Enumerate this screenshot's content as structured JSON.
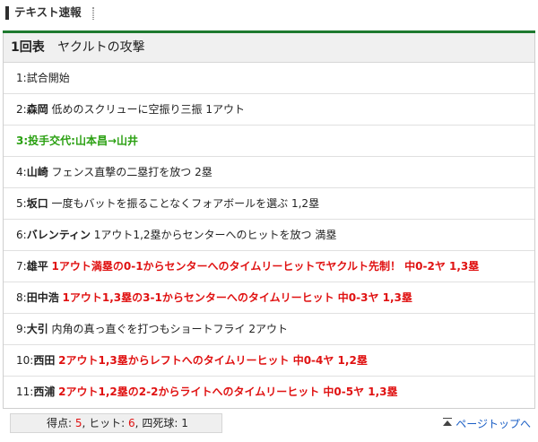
{
  "header": {
    "title": "テキスト速報"
  },
  "inning": {
    "label": "1回表",
    "team": "ヤクルトの攻撃"
  },
  "events": [
    {
      "num": "1:",
      "player": "",
      "desc": "試合開始",
      "style": "normal"
    },
    {
      "num": "2:",
      "player": "森岡",
      "desc": "低めのスクリューに空振り三振 1アウト",
      "style": "normal"
    },
    {
      "num": "3:",
      "player": "",
      "desc": "投手交代:山本昌→山井",
      "style": "sub"
    },
    {
      "num": "4:",
      "player": "山崎",
      "desc": "フェンス直撃の二塁打を放つ 2塁",
      "style": "normal"
    },
    {
      "num": "5:",
      "player": "坂口",
      "desc": "一度もバットを振ることなくフォアボールを選ぶ 1,2塁",
      "style": "normal"
    },
    {
      "num": "6:",
      "player": "バレンティン",
      "desc": "1アウト1,2塁からセンターへのヒットを放つ 満塁",
      "style": "normal"
    },
    {
      "num": "7:",
      "player": "雄平",
      "desc": "1アウト満塁の0-1からセンターへのタイムリーヒットでヤクルト先制！ 中0-2ヤ 1,3塁",
      "style": "red"
    },
    {
      "num": "8:",
      "player": "田中浩",
      "desc": "1アウト1,3塁の3-1からセンターへのタイムリーヒット 中0-3ヤ 1,3塁",
      "style": "red"
    },
    {
      "num": "9:",
      "player": "大引",
      "desc": "内角の真っ直ぐを打つもショートフライ 2アウト",
      "style": "normal"
    },
    {
      "num": "10:",
      "player": "西田",
      "desc": "2アウト1,3塁からレフトへのタイムリーヒット 中0-4ヤ 1,2塁",
      "style": "red"
    },
    {
      "num": "11:",
      "player": "西浦",
      "desc": "2アウト1,2塁の2-2からライトへのタイムリーヒット 中0-5ヤ 1,3塁",
      "style": "red"
    }
  ],
  "summary": {
    "runs_label": "得点:",
    "runs": "5",
    "hits_label": "ヒット:",
    "hits": "6",
    "bb_label": "四死球:",
    "bb": "1"
  },
  "footer": {
    "page_top": "ページトップへ"
  },
  "colors": {
    "accent_green": "#1e7a2f",
    "highlight_red": "#e01212",
    "substitution_green": "#2aa011",
    "link_blue": "#1a5ec5"
  }
}
